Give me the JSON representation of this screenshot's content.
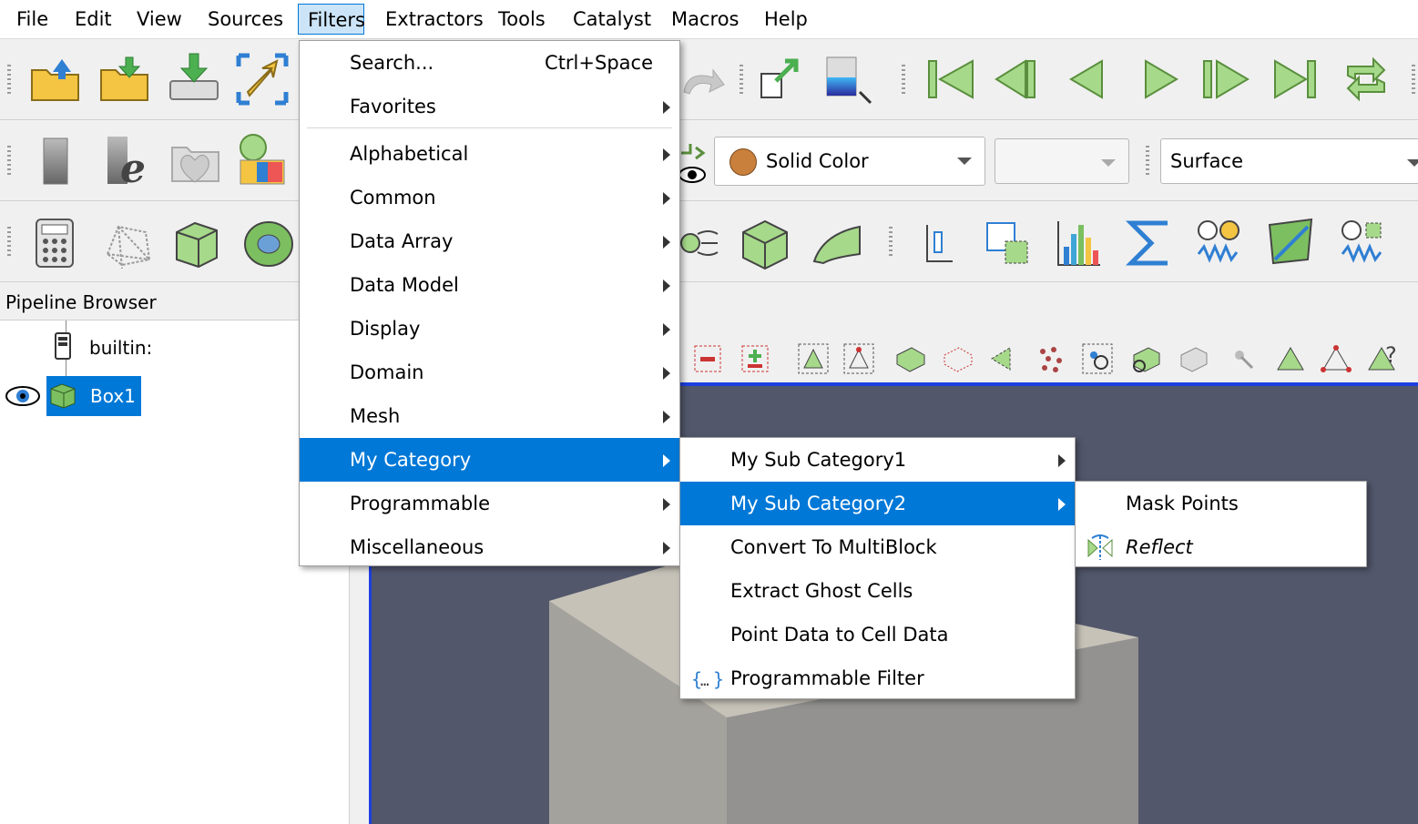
{
  "menubar": {
    "items": [
      "File",
      "Edit",
      "View",
      "Sources",
      "Filters",
      "Extractors",
      "Tools",
      "Catalyst",
      "Macros",
      "Help"
    ],
    "active": "Filters"
  },
  "display_toolbar": {
    "coloring": "Solid Color",
    "component": "",
    "representation": "Surface",
    "solid_color_swatch": "#c8803c"
  },
  "pipeline": {
    "header": "Pipeline Browser",
    "server": "builtin:",
    "source": "Box1"
  },
  "filters_menu": {
    "search_label": "Search...",
    "search_shortcut": "Ctrl+Space",
    "items": [
      "Favorites",
      "Alphabetical",
      "Common",
      "Data Array",
      "Data Model",
      "Display",
      "Domain",
      "Mesh",
      "My Category",
      "Programmable",
      "Miscellaneous"
    ],
    "highlighted": "My Category"
  },
  "my_category_menu": {
    "items": [
      "My Sub Category1",
      "My Sub Category2",
      "Convert To MultiBlock",
      "Extract Ghost Cells",
      "Point Data to Cell Data",
      "Programmable Filter"
    ],
    "highlighted": "My Sub Category2"
  },
  "sub_category2_menu": {
    "items": [
      "Mask Points",
      "Reflect"
    ]
  },
  "colors": {
    "accent": "#0078d7",
    "viewport_bg": "#52576b",
    "view_border": "#1e3fe0"
  }
}
